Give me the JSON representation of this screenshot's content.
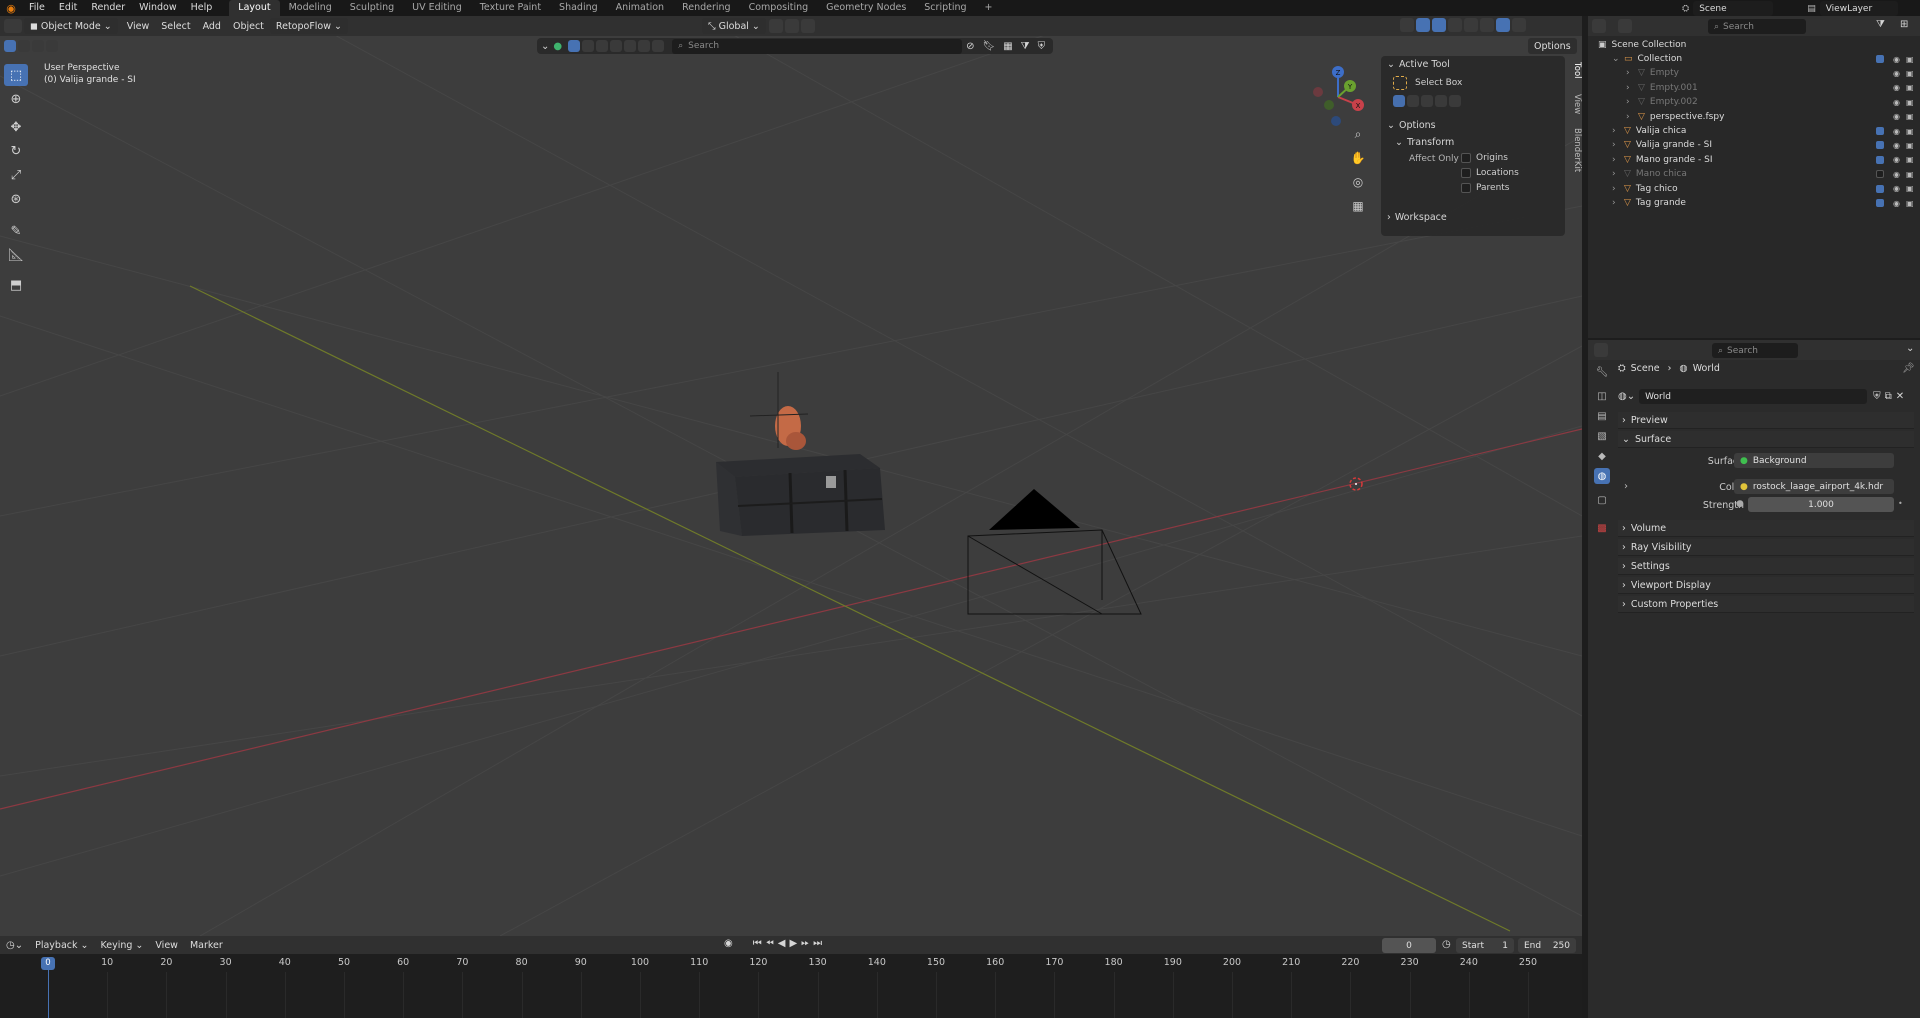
{
  "menubar": {
    "items": [
      "File",
      "Edit",
      "Render",
      "Window",
      "Help"
    ],
    "workspaces": [
      "Layout",
      "Modeling",
      "Sculpting",
      "UV Editing",
      "Texture Paint",
      "Shading",
      "Animation",
      "Rendering",
      "Compositing",
      "Geometry Nodes",
      "Scripting"
    ],
    "active_workspace": "Layout",
    "add_tab": "+",
    "scene": "Scene",
    "view_layer": "ViewLayer"
  },
  "viewport_header": {
    "mode": "Object Mode",
    "menus": [
      "View",
      "Select",
      "Add",
      "Object",
      "RetopoFlow"
    ],
    "orientation": "Global",
    "options": "Options",
    "search_placeholder": "Search"
  },
  "viewport": {
    "perspective": "User Perspective",
    "active_object": "(0) Valija grande - SI",
    "gizmo": {
      "x": "X",
      "y": "Y",
      "z": "Z"
    }
  },
  "npanel": {
    "active_tool_title": "Active Tool",
    "active_tool_name": "Select Box",
    "options_title": "Options",
    "transform_title": "Transform",
    "affect_only": "Affect Only",
    "checkboxes": [
      "Origins",
      "Locations",
      "Parents"
    ],
    "workspace": "Workspace",
    "tabs": [
      "Tool",
      "View",
      "BlenderKit"
    ]
  },
  "outliner": {
    "search_placeholder": "Search",
    "root": "Scene Collection",
    "rows": [
      {
        "name": "Collection",
        "level": 1,
        "dim": false
      },
      {
        "name": "Empty",
        "level": 2,
        "dim": true
      },
      {
        "name": "Empty.001",
        "level": 2,
        "dim": true
      },
      {
        "name": "Empty.002",
        "level": 2,
        "dim": true
      },
      {
        "name": "perspective.fspy",
        "level": 2,
        "dim": false
      },
      {
        "name": "Valija chica",
        "level": 1,
        "dim": false
      },
      {
        "name": "Valija grande - SI",
        "level": 1,
        "dim": false
      },
      {
        "name": "Mano grande - SI",
        "level": 1,
        "dim": false
      },
      {
        "name": "Mano chica",
        "level": 1,
        "dim": true
      },
      {
        "name": "Tag chico",
        "level": 1,
        "dim": false
      },
      {
        "name": "Tag grande",
        "level": 1,
        "dim": false
      }
    ]
  },
  "properties": {
    "search_placeholder": "Search",
    "breadcrumb": [
      "Scene",
      "World"
    ],
    "world_name": "World",
    "sections": [
      "Preview",
      "Surface",
      "Volume",
      "Ray Visibility",
      "Settings",
      "Viewport Display",
      "Custom Properties"
    ],
    "surface_label": "Surface",
    "surface_value": "Background",
    "color_label": "Color",
    "color_value": "rostock_laage_airport_4k.hdr",
    "strength_label": "Strength",
    "strength_value": "1.000"
  },
  "timeline": {
    "menus": [
      "Playback",
      "Keying",
      "View",
      "Marker"
    ],
    "current_frame": "0",
    "start_label": "Start",
    "start_value": "1",
    "end_label": "End",
    "end_value": "250",
    "ticks": [
      "0",
      "10",
      "20",
      "30",
      "40",
      "50",
      "60",
      "70",
      "80",
      "90",
      "100",
      "110",
      "120",
      "130",
      "140",
      "150",
      "160",
      "170",
      "180",
      "190",
      "200",
      "210",
      "220",
      "230",
      "240",
      "250"
    ]
  },
  "colors": {
    "accent": "#4772b3",
    "viewport_bg": "#3d3d3d",
    "x_axis": "#a33c48",
    "y_axis": "#7a8a2c"
  }
}
